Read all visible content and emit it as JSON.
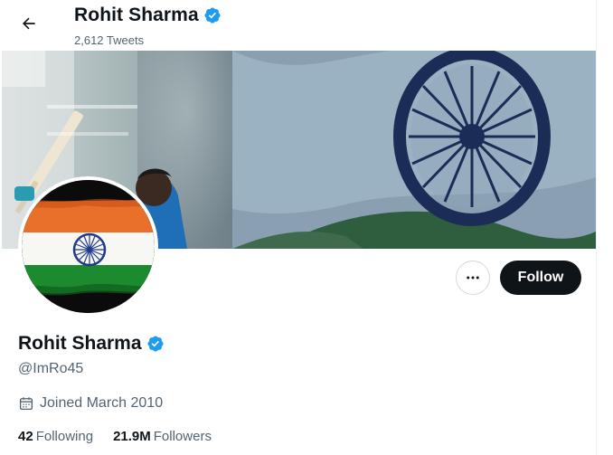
{
  "header": {
    "title": "Rohit Sharma",
    "tweet_count": "2,612 Tweets"
  },
  "profile": {
    "display_name": "Rohit Sharma",
    "handle": "@ImRo45",
    "joined": "Joined March 2010",
    "verified_icon": "verified-badge-icon"
  },
  "actions": {
    "more_icon": "more-dots-icon",
    "follow_label": "Follow"
  },
  "stats": {
    "following_count": "42",
    "following_label": "Following",
    "followers_count": "21.9M",
    "followers_label": "Followers"
  },
  "colors": {
    "verified": "#1d9bf0",
    "text_primary": "#0f1419",
    "text_secondary": "#536471",
    "follow_bg": "#0f1419",
    "flag_saffron": "#e8702a",
    "flag_green": "#1c8a2e",
    "chakra_blue": "#1f3a8a"
  }
}
